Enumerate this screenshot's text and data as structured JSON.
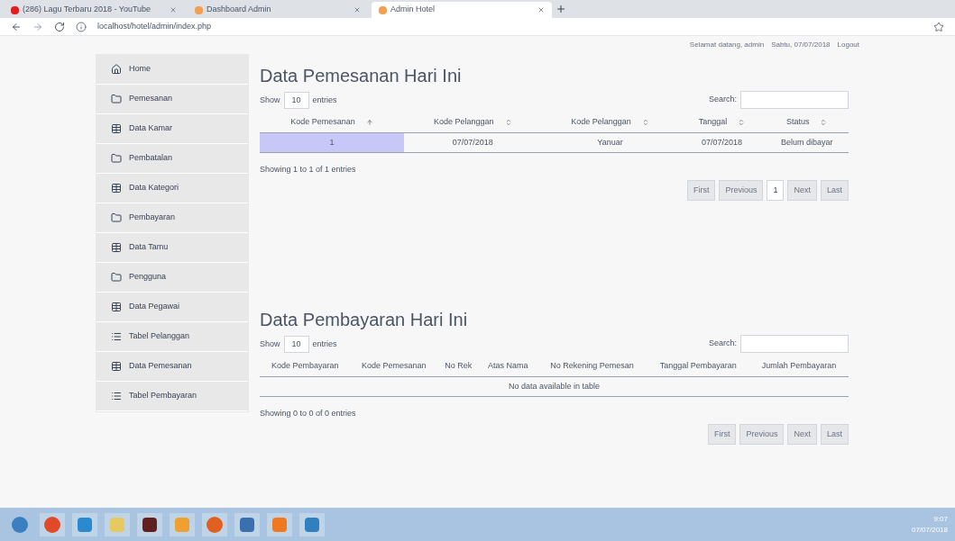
{
  "browser": {
    "tabs": [
      {
        "title": "(286) Lagu Terbaru 2018 - YouTube",
        "selected": false,
        "color": "#e02020"
      },
      {
        "title": "Dashboard Admin",
        "selected": false,
        "color": "#f0a050"
      },
      {
        "title": "Admin Hotel",
        "selected": true,
        "color": "#f0a050"
      }
    ],
    "url": "localhost/hotel/admin/index.php"
  },
  "header": {
    "greeting": "Selamat datang, admin",
    "date": "Sabtu, 07/07/2018",
    "logout": "Logout"
  },
  "sidebar": {
    "items": [
      {
        "label": "Home",
        "kind": "home",
        "selected": false
      },
      {
        "label": "Pemesanan",
        "kind": "folder",
        "selected": false
      },
      {
        "label": "Data Kamar",
        "kind": "table",
        "selected": false
      },
      {
        "label": "Pembatalan",
        "kind": "folder",
        "selected": false
      },
      {
        "label": "Data Kategori",
        "kind": "table",
        "selected": false
      },
      {
        "label": "Pembayaran",
        "kind": "folder",
        "selected": false
      },
      {
        "label": "Data Tamu",
        "kind": "table",
        "selected": false
      },
      {
        "label": "Pengguna",
        "kind": "folder",
        "selected": false
      },
      {
        "label": "Data Pegawai",
        "kind": "table",
        "selected": false
      },
      {
        "label": "Tabel Pelanggan",
        "kind": "list",
        "selected": false
      },
      {
        "label": "Data Pemesanan",
        "kind": "table",
        "selected": false
      },
      {
        "label": "Tabel Pembayaran",
        "kind": "list",
        "selected": false
      }
    ]
  },
  "sections": [
    {
      "title": "Data Pemesanan Hari Ini",
      "show_label": "Show",
      "page_size": "10",
      "entries_label": "entries",
      "search_label": "Search:",
      "columns": [
        "Kode Pemesanan",
        "Kode Pelanggan",
        "Kode Pelanggan",
        "Tanggal",
        "Status"
      ],
      "rows": [
        [
          "1",
          "07/07/2018",
          "Yanuar",
          "07/07/2018",
          "Belum dibayar"
        ]
      ],
      "info": "Showing 1 to 1 of 1 entries",
      "pagination": [
        {
          "label": "First",
          "selected": false
        },
        {
          "label": "Previous",
          "selected": false
        },
        {
          "label": "1",
          "selected": true
        },
        {
          "label": "Next",
          "selected": false
        },
        {
          "label": "Last",
          "selected": false
        }
      ]
    },
    {
      "title": "Data Pembayaran Hari Ini",
      "show_label": "Show",
      "page_size": "10",
      "entries_label": "entries",
      "search_label": "Search:",
      "columns": [
        "Kode Pembayaran",
        "Kode Pemesanan",
        "No Rek",
        "Atas Nama",
        "No Rekening Pemesan",
        "Tanggal Pembayaran",
        "Jumlah Pembayaran"
      ],
      "empty": "No data available in table",
      "info": "Showing 0 to 0 of 0 entries",
      "pagination": [
        {
          "label": "First",
          "selected": false
        },
        {
          "label": "Previous",
          "selected": false
        },
        {
          "label": "Next",
          "selected": false
        },
        {
          "label": "Last",
          "selected": false
        }
      ]
    }
  ],
  "taskbar": {
    "time": "9:07",
    "date": "07/07/2018",
    "apps": [
      {
        "kind": "start",
        "color": "#3a7fc0"
      },
      {
        "kind": "chrome",
        "color": "#e04a2a"
      },
      {
        "kind": "browser",
        "color": "#2a8ad0"
      },
      {
        "kind": "folder",
        "color": "#e8c860"
      },
      {
        "kind": "app",
        "color": "#602020"
      },
      {
        "kind": "media",
        "color": "#f0a030"
      },
      {
        "kind": "firefox",
        "color": "#e06020"
      },
      {
        "kind": "python",
        "color": "#3a70b0"
      },
      {
        "kind": "xampp",
        "color": "#f07820"
      },
      {
        "kind": "app",
        "color": "#3080c0"
      }
    ]
  }
}
